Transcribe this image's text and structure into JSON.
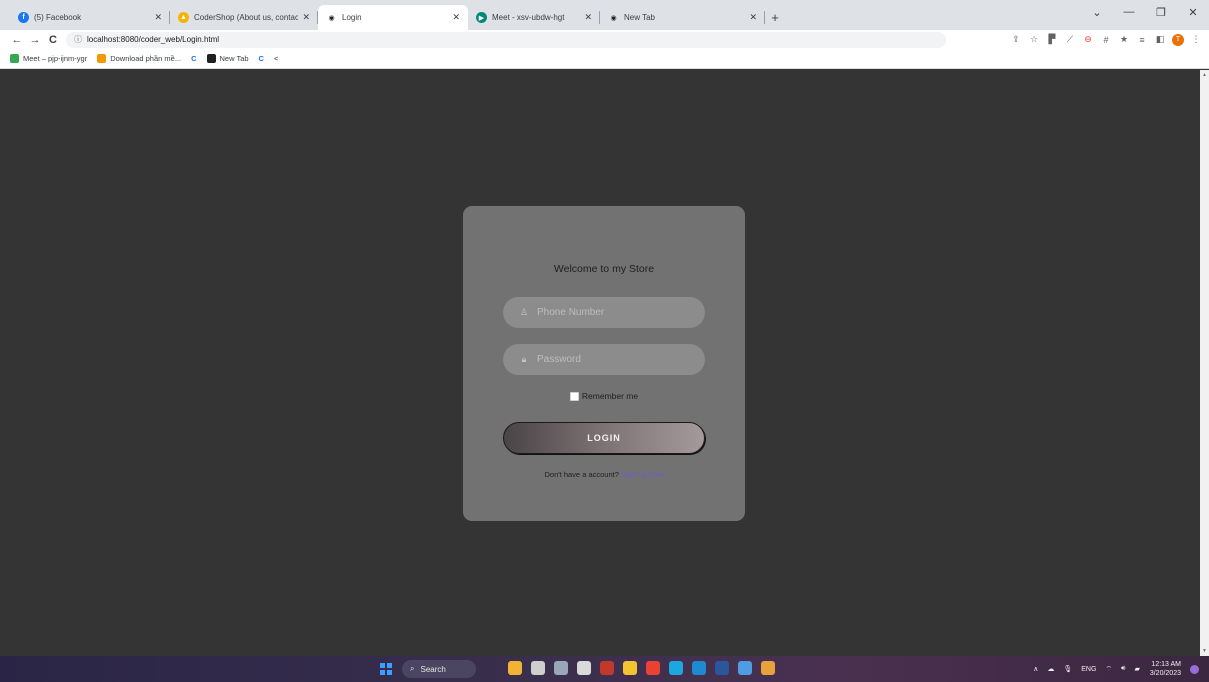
{
  "browser": {
    "tabs": [
      {
        "title": "(5) Facebook",
        "favicon": "facebook-icon",
        "color": "#1877f2",
        "glyph": "f",
        "active": false
      },
      {
        "title": "CoderShop (About us, contact) - ",
        "favicon": "drive-icon",
        "color": "#f4b400",
        "glyph": "▲",
        "active": false
      },
      {
        "title": "Login",
        "favicon": "globe-icon",
        "color": "#202124",
        "glyph": "◉",
        "active": true
      },
      {
        "title": "Meet - xsv-ubdw-hgt",
        "favicon": "meet-icon",
        "color": "#00897b",
        "glyph": "▶",
        "active": false
      },
      {
        "title": "New Tab",
        "favicon": "globe-icon",
        "color": "#202124",
        "glyph": "◉",
        "active": false
      }
    ],
    "close_glyph": "✕",
    "new_tab_glyph": "+",
    "window_controls": [
      "⌄",
      "—",
      "❐",
      "✕"
    ],
    "address": "localhost:8080/coder_web/Login.html",
    "nav": {
      "back": "←",
      "forward": "→",
      "reload": "C",
      "info": "ⓘ"
    },
    "toolbar_icons": [
      "⇪",
      "☆",
      "▛",
      "⟋",
      "⊖",
      "#",
      "★",
      "≡",
      "◧"
    ],
    "profile_initial": "T",
    "menu_glyph": "⋮",
    "bookmarks": [
      {
        "label": "Meet – pjp-ijnm-ygr",
        "color": "#34a853"
      },
      {
        "label": "Download phần mề...",
        "color": "#f29900"
      },
      {
        "label": "C",
        "color": "#1a73e8"
      },
      {
        "label": "New Tab",
        "color": "#202124"
      },
      {
        "label": "C",
        "color": "#1a73e8"
      },
      {
        "label": "<",
        "color": "#ffffff"
      }
    ]
  },
  "login": {
    "heading": "Welcome to my Store",
    "phone_placeholder": "Phone Number",
    "password_placeholder": "Password",
    "remember_label": "Remember me",
    "login_label": "LOGIN",
    "signup_prompt": "Don't have a account?",
    "signup_link": "Sign Up now",
    "user_glyph": "♙",
    "lock_glyph": "🔒︎"
  },
  "taskbar": {
    "search_label": "Search",
    "search_glyph": "⌕",
    "apps": [
      {
        "name": "widgets-icon",
        "color": "#f2b233"
      },
      {
        "name": "task-view-icon",
        "color": "#cfcfcf"
      },
      {
        "name": "settings-icon",
        "color": "#9aa7b8"
      },
      {
        "name": "app-icon",
        "color": "#d9d9d9"
      },
      {
        "name": "red-app-icon",
        "color": "#c0392b"
      },
      {
        "name": "file-explorer-icon",
        "color": "#f4c430"
      },
      {
        "name": "chrome-icon",
        "color": "#e94235"
      },
      {
        "name": "edge-icon",
        "color": "#1ba8e0"
      },
      {
        "name": "vscode-icon",
        "color": "#1f8ad2"
      },
      {
        "name": "word-icon",
        "color": "#2b579a"
      },
      {
        "name": "notepad-icon",
        "color": "#4d9de0"
      },
      {
        "name": "game-icon",
        "color": "#e8a23b"
      }
    ],
    "tray": {
      "chevron": "∧",
      "cloud": "☁",
      "mic": "🎙︎",
      "lang": "ENG",
      "wifi": "⌔",
      "volume": "🔊︎",
      "battery": "▰"
    },
    "time": "12:13 AM",
    "date": "3/20/2023"
  }
}
